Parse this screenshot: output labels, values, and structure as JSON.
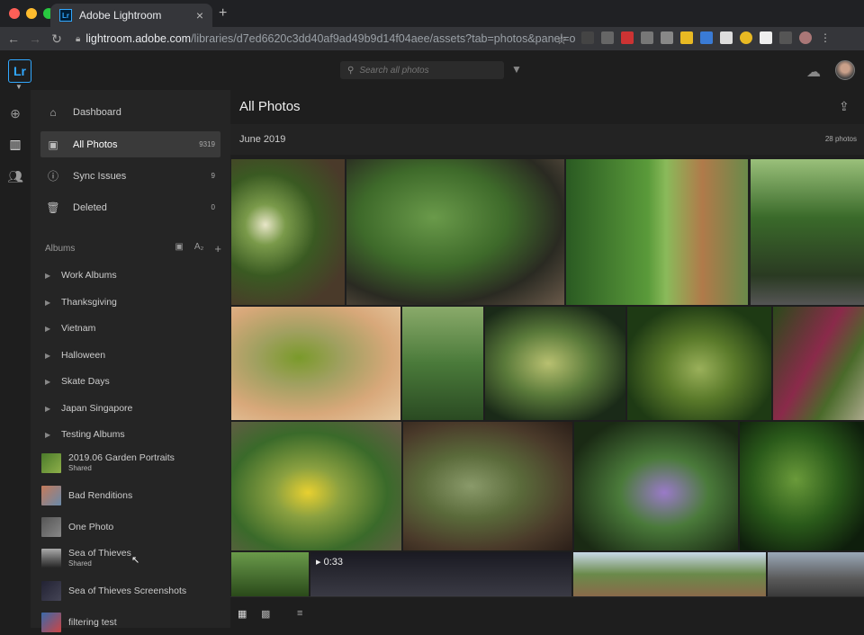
{
  "browser": {
    "tab_title": "Adobe Lightroom",
    "tab_favicon": "Lr",
    "url_host": "lightroom.adobe.com",
    "url_path": "/libraries/d7ed6620c3dd40af9ad49b9d14f04aee/assets?tab=photos&panel=or..."
  },
  "app": {
    "logo": "Lr",
    "search_placeholder": "Search all photos"
  },
  "sidebar": {
    "items": [
      {
        "label": "Dashboard",
        "icon": "home-icon",
        "count": ""
      },
      {
        "label": "All Photos",
        "icon": "photos-icon",
        "count": "9319"
      },
      {
        "label": "Sync Issues",
        "icon": "alert-icon",
        "count": "9"
      },
      {
        "label": "Deleted",
        "icon": "trash-icon",
        "count": "0"
      }
    ],
    "albums_header": "Albums",
    "albums_sort": "A₂",
    "folders": [
      "Work Albums",
      "Thanksgiving",
      "Vietnam",
      "Halloween",
      "Skate Days",
      "Japan Singapore",
      "Testing Albums"
    ],
    "albums": [
      {
        "label": "2019.06 Garden Portraits",
        "sub": "Shared"
      },
      {
        "label": "Bad Renditions",
        "sub": ""
      },
      {
        "label": "One Photo",
        "sub": ""
      },
      {
        "label": "Sea of Thieves",
        "sub": "Shared"
      },
      {
        "label": "Sea of Thieves Screenshots",
        "sub": ""
      },
      {
        "label": "filtering test",
        "sub": ""
      }
    ]
  },
  "main": {
    "title": "All Photos",
    "date": "June 2019",
    "count": "28 photos",
    "video_duration": "0:33"
  },
  "colors": {
    "accent": "#31a8ff",
    "background": "#1e1e1e",
    "sidebar": "#252525"
  }
}
